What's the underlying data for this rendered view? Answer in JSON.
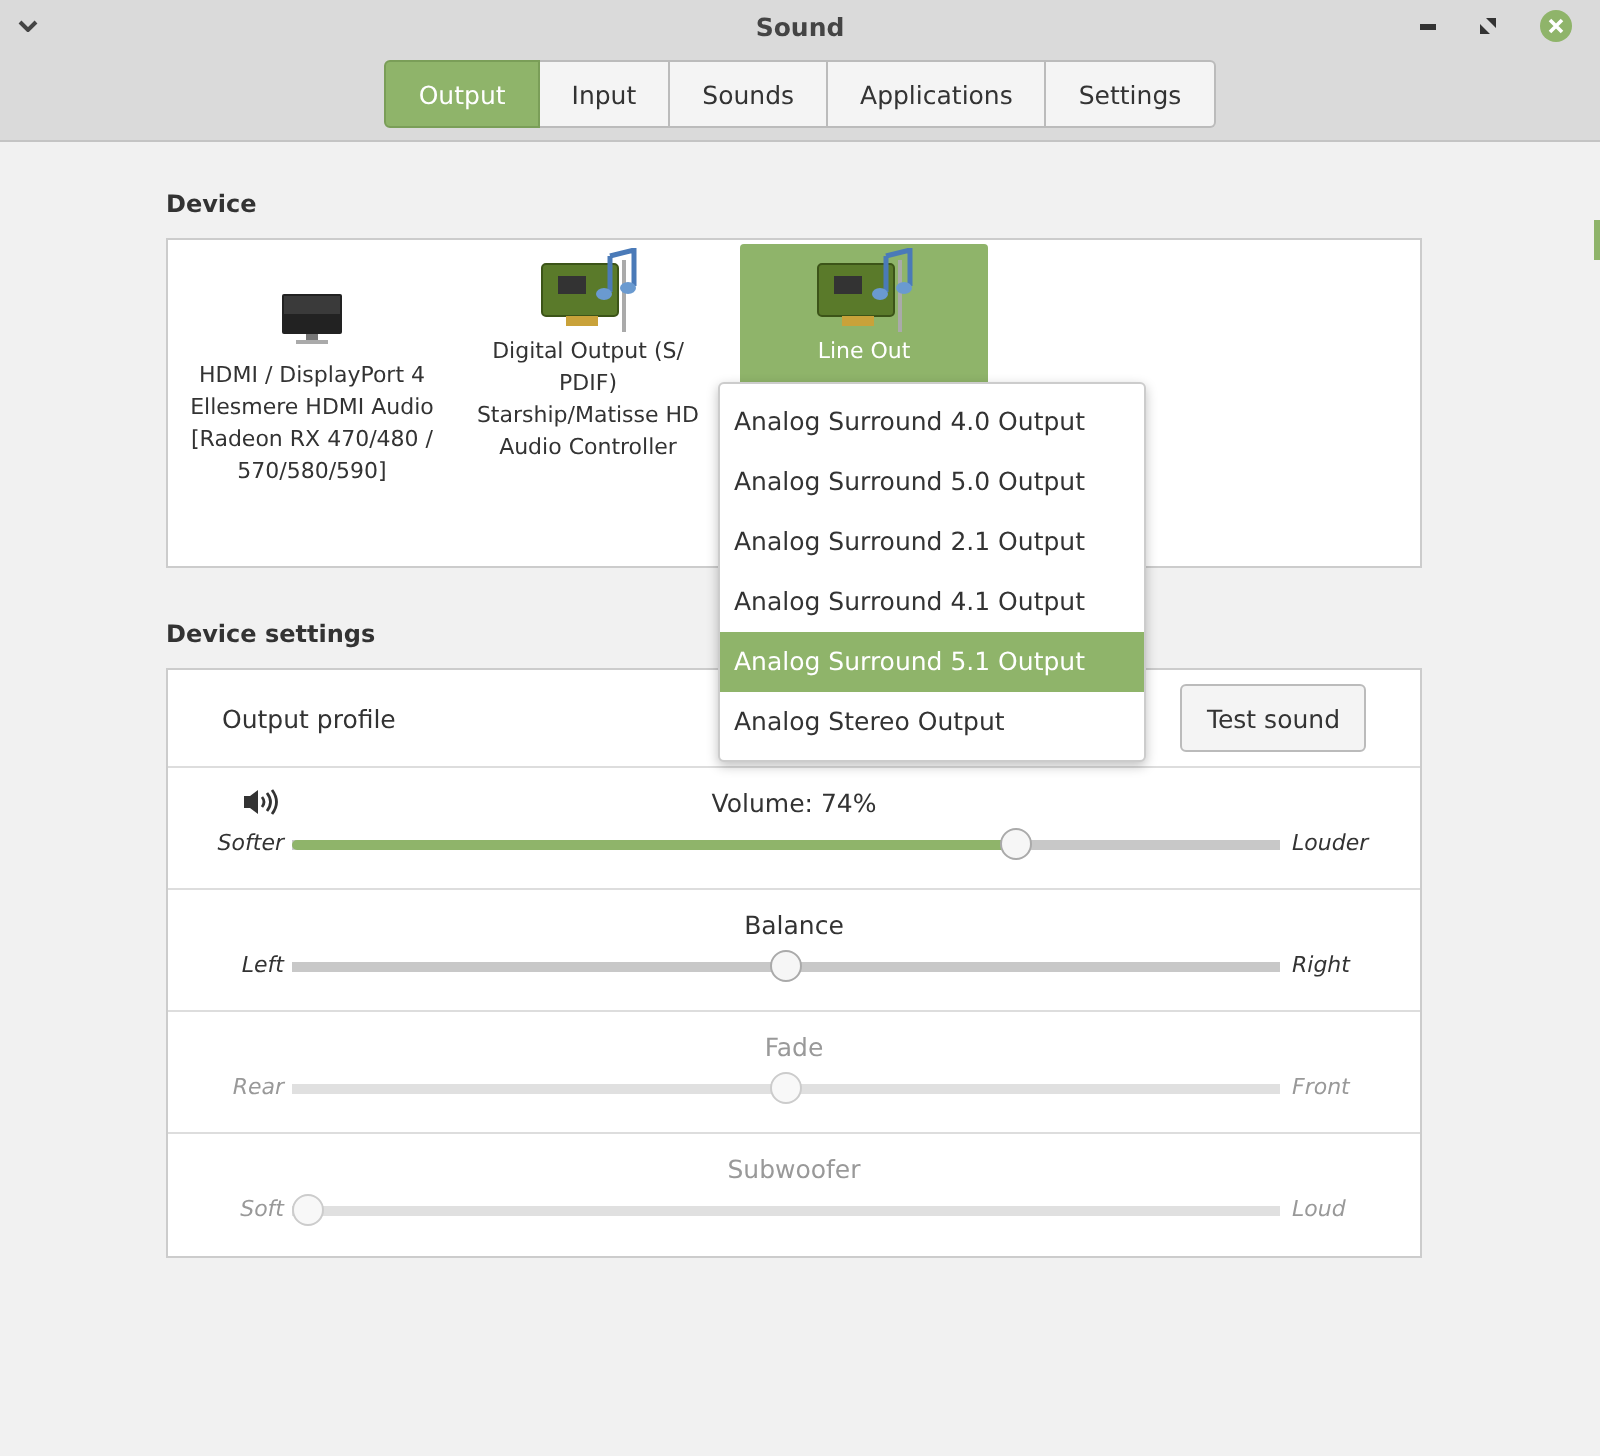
{
  "window": {
    "title": "Sound"
  },
  "tabs": [
    {
      "label": "Output",
      "selected": true
    },
    {
      "label": "Input",
      "selected": false
    },
    {
      "label": "Sounds",
      "selected": false
    },
    {
      "label": "Applications",
      "selected": false
    },
    {
      "label": "Settings",
      "selected": false
    }
  ],
  "device": {
    "heading": "Device",
    "devices": [
      {
        "kind": "monitor",
        "label": "HDMI / DisplayPort 4",
        "description": "Ellesmere HDMI Audio [Radeon RX 470/480 / 570/580/590]",
        "selected": false
      },
      {
        "kind": "card",
        "label": "Digital Output (S/ PDIF)",
        "description": "Starship/Matisse HD Audio Controller",
        "selected": false
      },
      {
        "kind": "card",
        "label": "Line Out",
        "selected": true
      }
    ]
  },
  "device_settings": {
    "heading": "Device settings",
    "output_profile": {
      "label": "Output profile",
      "options": [
        {
          "label": "Analog Surround 4.0 Output",
          "selected": false
        },
        {
          "label": "Analog Surround 5.0 Output",
          "selected": false
        },
        {
          "label": "Analog Surround 2.1 Output",
          "selected": false
        },
        {
          "label": "Analog Surround 4.1 Output",
          "selected": false
        },
        {
          "label": "Analog Surround 5.1 Output",
          "selected": true
        },
        {
          "label": "Analog Stereo Output",
          "selected": false
        }
      ]
    },
    "test_button": "Test sound",
    "sliders": [
      {
        "kind": "volume",
        "title": "Volume: 74%",
        "left": "Softer",
        "right": "Louder",
        "level": 0.74,
        "disabled": false
      },
      {
        "kind": "plain",
        "title": "Balance",
        "left": "Left",
        "right": "Right",
        "level": 0.5,
        "disabled": false
      },
      {
        "kind": "plain",
        "title": "Fade",
        "left": "Rear",
        "right": "Front",
        "level": 0.5,
        "disabled": true
      },
      {
        "kind": "plain",
        "title": "Subwoofer",
        "left": "Soft",
        "right": "Loud",
        "level": 0,
        "disabled": true
      }
    ]
  }
}
